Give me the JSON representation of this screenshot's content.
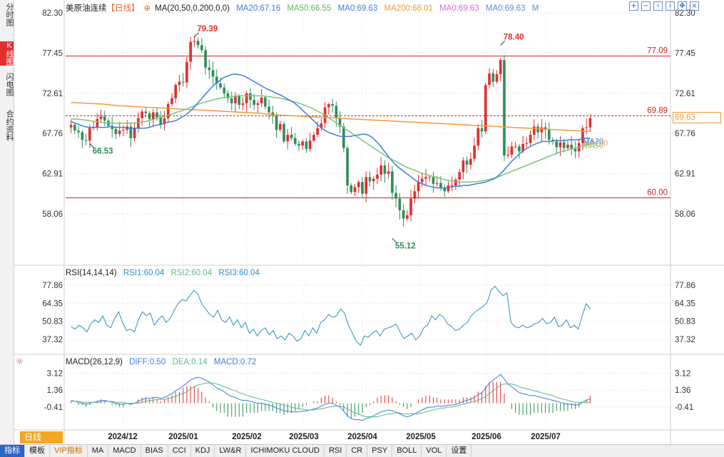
{
  "sidebar": {
    "tabs": [
      {
        "label": "分时图",
        "active": false
      },
      {
        "label": "K线图",
        "active": true
      },
      {
        "label": "闪电图",
        "active": false
      },
      {
        "label": "合约资料",
        "active": false
      }
    ]
  },
  "legend_main": {
    "name": "美原油连续",
    "period": "【日线】",
    "ma_params": "MA(20,50,0,200,0,0)",
    "ma20": "MA20:67.16",
    "ma50": "MA50:66.55",
    "ma0a": "MA0:69.63",
    "ma200": "MA200:68.01",
    "ma0b": "MA0:69.63",
    "ma0c": "MA0:69.63",
    "m": "M"
  },
  "legend_rsi": {
    "params": "RSI(14,14,14)",
    "rsi1": "RSI1:60.04",
    "rsi2": "RSI2:60.04",
    "rsi3": "RSI3:60.04"
  },
  "legend_macd": {
    "params": "MACD(26,12,9)",
    "diff": "DIFF:0.50",
    "dea": "DEA:0.14",
    "macd": "MACD:0.72"
  },
  "toolbar_icons": [
    "plus-icon",
    "minus-icon",
    "left-icon",
    "right-icon",
    "move-icon",
    "close-icon"
  ],
  "period_tab": "日线",
  "current_price": "69.63",
  "bottom_bar": [
    {
      "label": "指标",
      "style": "active"
    },
    {
      "label": "模板",
      "style": ""
    },
    {
      "label": "VIP指标",
      "style": "vip"
    },
    {
      "label": "MA",
      "style": ""
    },
    {
      "label": "MACD",
      "style": ""
    },
    {
      "label": "BIAS",
      "style": ""
    },
    {
      "label": "CCI",
      "style": ""
    },
    {
      "label": "KDJ",
      "style": ""
    },
    {
      "label": "LW&R",
      "style": ""
    },
    {
      "label": "ICHIMOKU CLOUD",
      "style": ""
    },
    {
      "label": "RSI",
      "style": ""
    },
    {
      "label": "CR",
      "style": ""
    },
    {
      "label": "PSY",
      "style": ""
    },
    {
      "label": "BOLL",
      "style": ""
    },
    {
      "label": "VOL",
      "style": ""
    },
    {
      "label": "设置",
      "style": ""
    }
  ],
  "colors": {
    "up": "#e03030",
    "down": "#2f8f5a",
    "ma20": "#3b7fd9",
    "ma50": "#7cc47c",
    "ma200": "#f29a3c",
    "hline": "#d02020",
    "rsi": "#2a90c0",
    "diff": "#3b7fd9",
    "dea": "#5cb88a",
    "grid": "#e6e6e6"
  },
  "chart_data": {
    "type": "candlestick",
    "main": {
      "y_ticks": [
        82.3,
        77.45,
        72.61,
        67.76,
        62.91,
        58.06
      ],
      "y_range": [
        53.6,
        82.3
      ],
      "x_labels": [
        "2024/12",
        "2025/01",
        "2025/02",
        "2025/03",
        "2025/04",
        "2025/05",
        "2025/06",
        "2025/07"
      ],
      "hlines": [
        {
          "value": 77.09,
          "label": "77.09",
          "style": "solid"
        },
        {
          "value": 69.89,
          "label": "69.89",
          "style": "dashed"
        },
        {
          "value": 60.0,
          "label": "60.00",
          "style": "solid"
        }
      ],
      "annotations": [
        {
          "label": "79.39",
          "value": 79.39
        },
        {
          "label": "78.40",
          "value": 78.4
        },
        {
          "label": "66.53",
          "value": 66.53
        },
        {
          "label": "55.12",
          "value": 55.12
        }
      ],
      "ma_end_labels": [
        "MA200",
        "MA20",
        "MA50"
      ],
      "closes": [
        68.8,
        68.1,
        67.9,
        67.0,
        66.9,
        68.4,
        68.5,
        69.5,
        69.8,
        69.3,
        68.7,
        68.3,
        67.7,
        68.1,
        68.2,
        68.6,
        67.2,
        68.4,
        69.6,
        70.4,
        70.2,
        69.5,
        70.3,
        69.7,
        68.9,
        69.6,
        71.3,
        72.0,
        73.6,
        74.0,
        73.9,
        76.4,
        78.8,
        78.9,
        78.4,
        77.8,
        75.7,
        75.4,
        74.6,
        73.8,
        73.3,
        72.6,
        72.0,
        71.4,
        72.3,
        71.2,
        71.4,
        72.6,
        71.8,
        71.2,
        71.4,
        72.1,
        71.0,
        70.3,
        69.9,
        68.2,
        68.9,
        66.8,
        67.6,
        67.2,
        66.5,
        66.3,
        66.8,
        65.9,
        66.9,
        67.6,
        68.4,
        69.0,
        70.9,
        71.3,
        71.1,
        69.6,
        68.6,
        66.0,
        61.5,
        60.7,
        61.3,
        61.9,
        60.5,
        62.5,
        62.0,
        62.3,
        62.8,
        63.9,
        62.9,
        63.2,
        60.6,
        59.9,
        58.5,
        57.5,
        57.9,
        59.9,
        60.8,
        61.9,
        62.3,
        62.5,
        62.5,
        61.7,
        61.8,
        61.2,
        60.8,
        61.5,
        61.5,
        62.2,
        63.1,
        64.5,
        64.0,
        64.7,
        66.3,
        68.4,
        68.0,
        73.6,
        75.0,
        74.0,
        74.9,
        76.6,
        65.1,
        65.2,
        66.2,
        66.2,
        65.6,
        66.5,
        66.6,
        67.6,
        68.6,
        67.9,
        68.5,
        68.2,
        67.0,
        66.8,
        66.1,
        66.7,
        66.0,
        66.4,
        65.9,
        65.6,
        66.6,
        68.4,
        68.5,
        69.6
      ],
      "ma20": [
        69.2,
        69.0,
        68.8,
        68.6,
        68.5,
        68.5,
        68.5,
        68.5,
        68.5,
        68.6,
        68.5,
        68.5,
        68.5,
        68.4,
        68.4,
        68.4,
        68.4,
        68.4,
        68.5,
        68.7,
        68.8,
        68.9,
        69.1,
        69.2,
        69.3,
        69.6,
        69.9,
        70.3,
        70.8,
        71.4,
        72.0,
        72.6,
        73.2,
        73.7,
        74.1,
        74.5,
        74.7,
        74.9,
        74.9,
        74.8,
        74.6,
        74.3,
        74.0,
        73.7,
        73.4,
        73.1,
        72.9,
        72.6,
        72.4,
        72.1,
        71.8,
        71.5,
        71.1,
        70.6,
        70.1,
        69.6,
        69.1,
        68.6,
        68.2,
        67.9,
        67.7,
        67.5,
        67.4,
        67.4,
        67.4,
        67.5,
        67.6,
        67.7,
        67.6,
        67.3,
        66.8,
        66.2,
        65.5,
        64.8,
        64.2,
        63.7,
        63.3,
        62.9,
        62.5,
        62.1,
        61.8,
        61.6,
        61.4,
        61.3,
        61.2,
        61.2,
        61.2,
        61.3,
        61.4,
        61.4,
        61.5,
        61.5,
        61.6,
        61.7,
        61.8,
        61.9,
        62.1,
        62.3,
        62.7,
        63.2,
        63.8,
        64.4,
        64.9,
        65.4,
        65.8,
        66.1,
        66.4,
        66.6,
        66.8,
        66.8,
        66.8,
        66.9,
        66.9,
        66.9,
        67.0,
        67.0,
        67.0,
        67.1,
        67.2,
        67.2
      ],
      "ma50": [
        69.5,
        69.5,
        69.4,
        69.3,
        69.2,
        69.1,
        69.0,
        69.0,
        69.0,
        69.0,
        69.0,
        69.1,
        69.2,
        69.4,
        69.6,
        69.8,
        70.0,
        70.3,
        70.5,
        70.8,
        71.1,
        71.4,
        71.6,
        71.8,
        72.0,
        72.1,
        72.2,
        72.3,
        72.3,
        72.3,
        72.3,
        72.3,
        72.2,
        72.1,
        72.0,
        71.8,
        71.6,
        71.4,
        71.1,
        70.8,
        70.4,
        70.0,
        69.5,
        69.0,
        68.5,
        68.0,
        67.5,
        67.0,
        66.5,
        66.0,
        65.5,
        65.0,
        64.6,
        64.2,
        63.8,
        63.5,
        63.2,
        62.9,
        62.7,
        62.5,
        62.3,
        62.1,
        62.0,
        61.9,
        61.9,
        61.9,
        62.0,
        62.1,
        62.3,
        62.5,
        62.8,
        63.1,
        63.4,
        63.7,
        64.0,
        64.3,
        64.6,
        64.9,
        65.2,
        65.5,
        65.7,
        65.9,
        66.1,
        66.3,
        66.5
      ],
      "ma200": [
        71.5,
        71.4,
        71.3,
        71.1,
        71.0,
        70.9,
        70.8,
        70.7,
        70.6,
        70.5,
        70.4,
        70.3,
        70.2,
        70.0,
        69.9,
        69.8,
        69.7,
        69.6,
        69.5,
        69.4,
        69.3,
        69.2,
        69.1,
        69.0,
        68.9,
        68.8,
        68.7,
        68.6,
        68.5,
        68.4,
        68.3,
        68.2,
        68.1,
        68.0
      ]
    },
    "rsi": {
      "y_ticks": [
        77.86,
        64.35,
        50.83,
        37.32
      ],
      "y_range": [
        30,
        82
      ],
      "values": [
        47,
        45,
        48,
        46,
        43,
        49,
        52,
        50,
        55,
        48,
        46,
        53,
        58,
        50,
        44,
        45,
        43,
        52,
        58,
        55,
        57,
        48,
        52,
        55,
        50,
        53,
        59,
        64,
        67,
        66,
        70,
        74,
        71,
        64,
        60,
        56,
        54,
        59,
        52,
        50,
        54,
        48,
        52,
        46,
        50,
        42,
        45,
        40,
        44,
        46,
        41,
        44,
        38,
        40,
        37,
        42,
        40,
        36,
        38,
        44,
        40,
        46,
        42,
        50,
        52,
        56,
        54,
        55,
        60,
        57,
        48,
        42,
        36,
        33,
        40,
        39,
        42,
        44,
        40,
        45,
        46,
        47,
        49,
        43,
        38,
        40,
        42,
        37,
        40,
        46,
        48,
        55,
        52,
        56,
        54,
        49,
        47,
        44,
        45,
        48,
        50,
        55,
        58,
        60,
        62,
        65,
        74,
        77,
        73,
        70,
        72,
        50,
        47,
        46,
        48,
        46,
        47,
        49,
        50,
        53,
        49,
        50,
        54,
        47,
        48,
        52,
        46,
        48,
        45,
        55,
        64,
        60
      ]
    },
    "macd": {
      "y_ticks": [
        3.12,
        1.36,
        -0.41
      ],
      "y_range": [
        -2.4,
        3.6
      ],
      "diff": [
        0.3,
        0.2,
        0.1,
        0.0,
        -0.1,
        0.0,
        0.1,
        0.2,
        0.3,
        0.3,
        0.2,
        0.1,
        0.0,
        -0.1,
        -0.1,
        0.0,
        -0.1,
        0.0,
        0.2,
        0.4,
        0.5,
        0.5,
        0.6,
        0.6,
        0.5,
        0.6,
        0.8,
        1.0,
        1.3,
        1.5,
        1.8,
        2.1,
        2.4,
        2.6,
        2.7,
        2.6,
        2.4,
        2.2,
        1.9,
        1.6,
        1.4,
        1.2,
        0.9,
        0.7,
        0.6,
        0.4,
        0.3,
        0.3,
        0.2,
        0.1,
        0.0,
        0.0,
        -0.1,
        -0.2,
        -0.3,
        -0.5,
        -0.6,
        -0.8,
        -0.8,
        -0.9,
        -0.9,
        -0.9,
        -0.8,
        -0.8,
        -0.7,
        -0.6,
        -0.5,
        -0.3,
        -0.1,
        0.0,
        0.0,
        -0.2,
        -0.4,
        -0.8,
        -1.3,
        -1.6,
        -1.7,
        -1.7,
        -1.8,
        -1.6,
        -1.5,
        -1.3,
        -1.1,
        -0.9,
        -0.8,
        -0.7,
        -0.8,
        -0.9,
        -1.1,
        -1.3,
        -1.4,
        -1.3,
        -1.1,
        -0.9,
        -0.7,
        -0.5,
        -0.4,
        -0.4,
        -0.3,
        -0.3,
        -0.3,
        -0.2,
        -0.2,
        -0.1,
        0.0,
        0.2,
        0.3,
        0.4,
        0.6,
        0.9,
        1.1,
        1.6,
        2.1,
        2.4,
        2.7,
        3.0,
        2.5,
        2.0,
        1.7,
        1.4,
        1.1,
        1.0,
        0.9,
        0.8,
        0.8,
        0.7,
        0.6,
        0.5,
        0.4,
        0.3,
        0.2,
        0.1,
        0.0,
        -0.1,
        -0.1,
        -0.2,
        -0.1,
        0.1,
        0.3,
        0.5
      ],
      "dea": [
        0.2,
        0.2,
        0.2,
        0.1,
        0.1,
        0.1,
        0.1,
        0.1,
        0.1,
        0.2,
        0.2,
        0.2,
        0.1,
        0.1,
        0.1,
        0.0,
        0.0,
        0.0,
        0.0,
        0.1,
        0.2,
        0.3,
        0.3,
        0.4,
        0.4,
        0.4,
        0.5,
        0.6,
        0.7,
        0.9,
        1.0,
        1.2,
        1.5,
        1.7,
        1.9,
        2.0,
        2.1,
        2.1,
        2.1,
        2.0,
        1.9,
        1.7,
        1.6,
        1.4,
        1.3,
        1.1,
        1.0,
        0.8,
        0.7,
        0.6,
        0.5,
        0.4,
        0.3,
        0.2,
        0.1,
        0.0,
        -0.1,
        -0.2,
        -0.3,
        -0.4,
        -0.5,
        -0.6,
        -0.6,
        -0.7,
        -0.7,
        -0.7,
        -0.6,
        -0.6,
        -0.5,
        -0.4,
        -0.3,
        -0.3,
        -0.3,
        -0.4,
        -0.6,
        -0.8,
        -1.0,
        -1.1,
        -1.3,
        -1.4,
        -1.4,
        -1.4,
        -1.4,
        -1.3,
        -1.2,
        -1.1,
        -1.1,
        -1.0,
        -1.0,
        -1.1,
        -1.1,
        -1.1,
        -1.1,
        -1.1,
        -1.0,
        -0.9,
        -0.8,
        -0.7,
        -0.6,
        -0.5,
        -0.5,
        -0.4,
        -0.4,
        -0.3,
        -0.2,
        -0.1,
        0.0,
        0.1,
        0.2,
        0.3,
        0.5,
        0.7,
        1.0,
        1.3,
        1.6,
        1.9,
        2.0,
        2.0,
        2.0,
        1.9,
        1.7,
        1.6,
        1.5,
        1.4,
        1.3,
        1.2,
        1.1,
        1.0,
        0.9,
        0.8,
        0.6,
        0.5,
        0.4,
        0.3,
        0.2,
        0.1,
        0.1,
        0.1,
        0.1,
        0.1
      ]
    }
  }
}
